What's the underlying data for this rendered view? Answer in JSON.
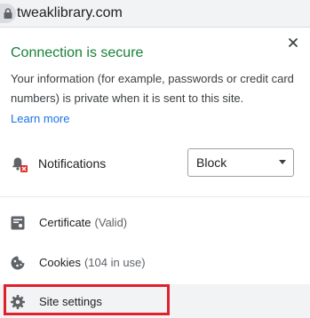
{
  "omnibox": {
    "url": "tweaklibrary.com",
    "icon": "lock-icon"
  },
  "bubble": {
    "title": "Connection is secure",
    "description": "Your information (for example, passwords or credit card numbers) is private when it is sent to this site.",
    "learn_more": "Learn more",
    "close_icon": "close-icon",
    "title_color": "#188038",
    "link_color": "#1a73e8"
  },
  "permission": {
    "label": "Notifications",
    "icon": "notifications-blocked-icon",
    "selected": "Block"
  },
  "menu": {
    "certificate": {
      "label": "Certificate",
      "status": "(Valid)",
      "icon": "certificate-icon"
    },
    "cookies": {
      "label": "Cookies",
      "status": "(104 in use)",
      "icon": "cookie-icon"
    },
    "site_settings": {
      "label": "Site settings",
      "icon": "gear-icon"
    }
  },
  "highlight_color": "#e0212b"
}
